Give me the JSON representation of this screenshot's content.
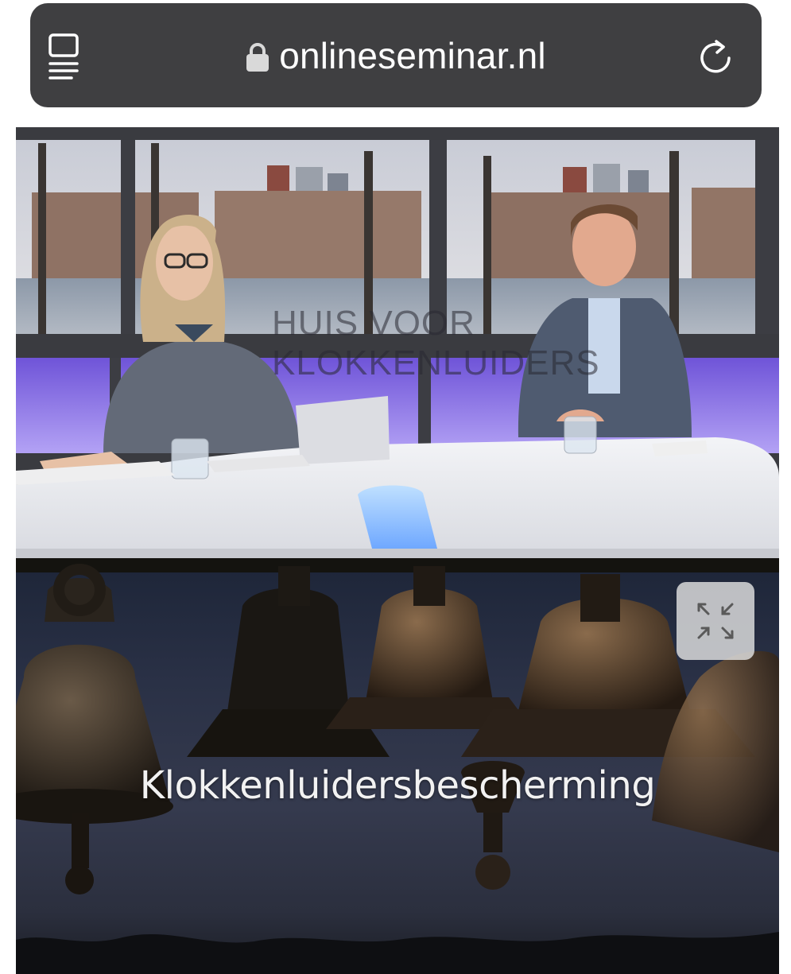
{
  "browser": {
    "url": "onlineseminar.nl",
    "tabs_icon": "tabs-icon",
    "lock_icon": "lock-icon",
    "reload_icon": "reload-icon"
  },
  "video": {
    "watermark_line1": "HUIS VOOR",
    "watermark_line2": "KLOKKENLUIDERS"
  },
  "slide": {
    "title": "Klokkenluidersbescherming",
    "fullscreen_icon": "exit-fullscreen-icon"
  },
  "colors": {
    "address_bar_bg": "#3f3f41",
    "studio_purple": "#8b6cf0",
    "desk_white": "#ecedf1"
  }
}
